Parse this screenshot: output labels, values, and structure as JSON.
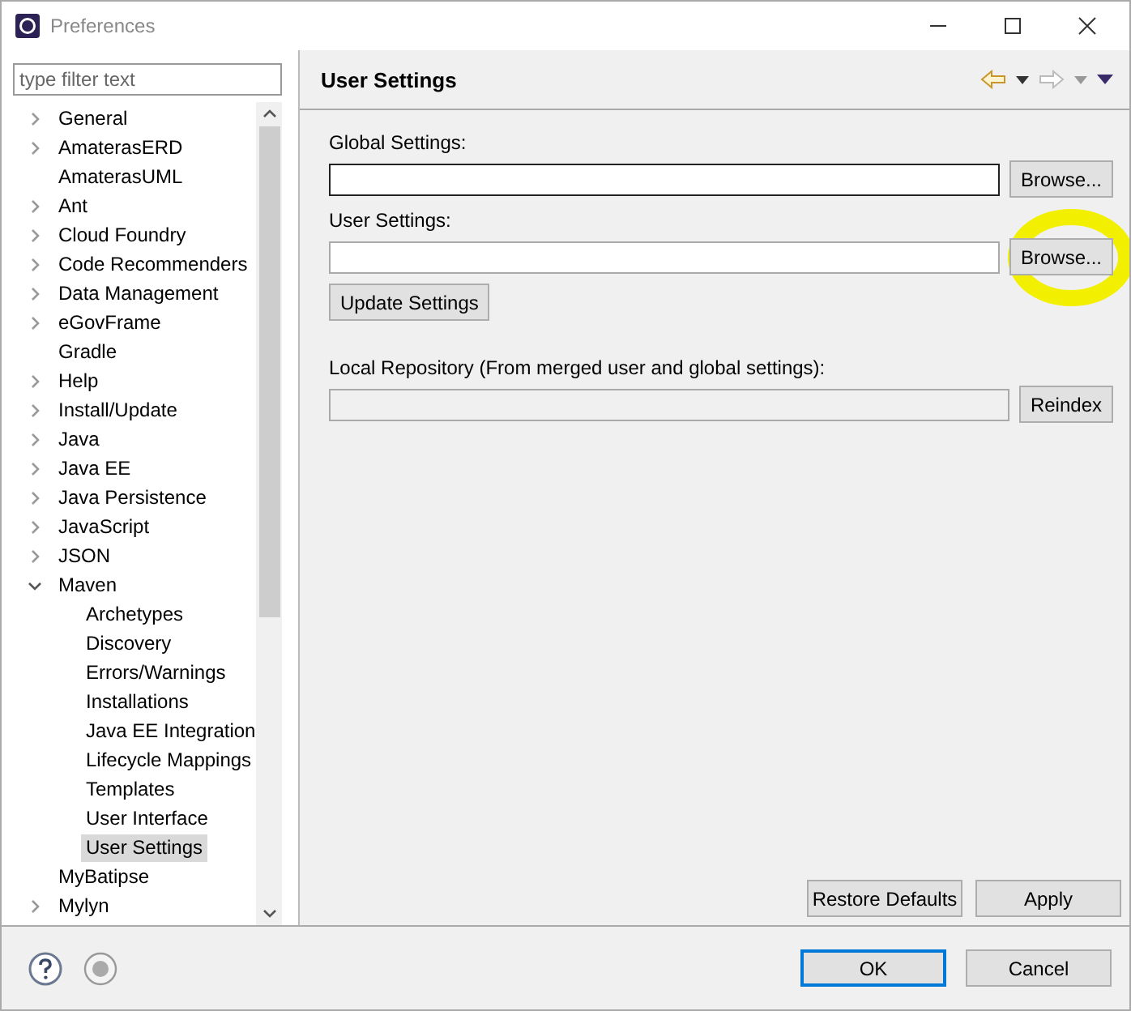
{
  "window": {
    "title": "Preferences"
  },
  "filter": {
    "placeholder": "type filter text"
  },
  "tree": [
    {
      "label": "General",
      "expanded": false,
      "selected": false
    },
    {
      "label": "AmaterasERD",
      "expanded": false,
      "selected": false
    },
    {
      "label": "AmaterasUML",
      "selected": false
    },
    {
      "label": "Ant",
      "expanded": false,
      "selected": false
    },
    {
      "label": "Cloud Foundry",
      "expanded": false,
      "selected": false
    },
    {
      "label": "Code Recommenders",
      "expanded": false,
      "selected": false
    },
    {
      "label": "Data Management",
      "expanded": false,
      "selected": false
    },
    {
      "label": "eGovFrame",
      "expanded": false,
      "selected": false
    },
    {
      "label": "Gradle",
      "selected": false
    },
    {
      "label": "Help",
      "expanded": false,
      "selected": false
    },
    {
      "label": "Install/Update",
      "expanded": false,
      "selected": false
    },
    {
      "label": "Java",
      "expanded": false,
      "selected": false
    },
    {
      "label": "Java EE",
      "expanded": false,
      "selected": false
    },
    {
      "label": "Java Persistence",
      "expanded": false,
      "selected": false
    },
    {
      "label": "JavaScript",
      "expanded": false,
      "selected": false
    },
    {
      "label": "JSON",
      "expanded": false,
      "selected": false
    },
    {
      "label": "Maven",
      "expanded": true,
      "selected": false,
      "children": [
        {
          "label": "Archetypes",
          "selected": false
        },
        {
          "label": "Discovery",
          "selected": false
        },
        {
          "label": "Errors/Warnings",
          "selected": false
        },
        {
          "label": "Installations",
          "selected": false
        },
        {
          "label": "Java EE Integration",
          "selected": false
        },
        {
          "label": "Lifecycle Mappings",
          "selected": false
        },
        {
          "label": "Templates",
          "selected": false
        },
        {
          "label": "User Interface",
          "selected": false
        },
        {
          "label": "User Settings",
          "selected": true
        }
      ]
    },
    {
      "label": "MyBatipse",
      "selected": false
    },
    {
      "label": "Mylyn",
      "expanded": false,
      "selected": false
    }
  ],
  "page": {
    "title": "User Settings",
    "global_settings": {
      "label": "Global Settings:",
      "button": "Browse..."
    },
    "user_settings": {
      "label": "User Settings:",
      "button": "Browse..."
    },
    "update_button": "Update Settings",
    "local_repository": {
      "label": "Local Repository (From merged user and global settings):",
      "button": "Reindex"
    },
    "restore_button": "Restore Defaults",
    "apply_button": "Apply"
  },
  "buttons": {
    "ok": "OK",
    "cancel": "Cancel"
  }
}
